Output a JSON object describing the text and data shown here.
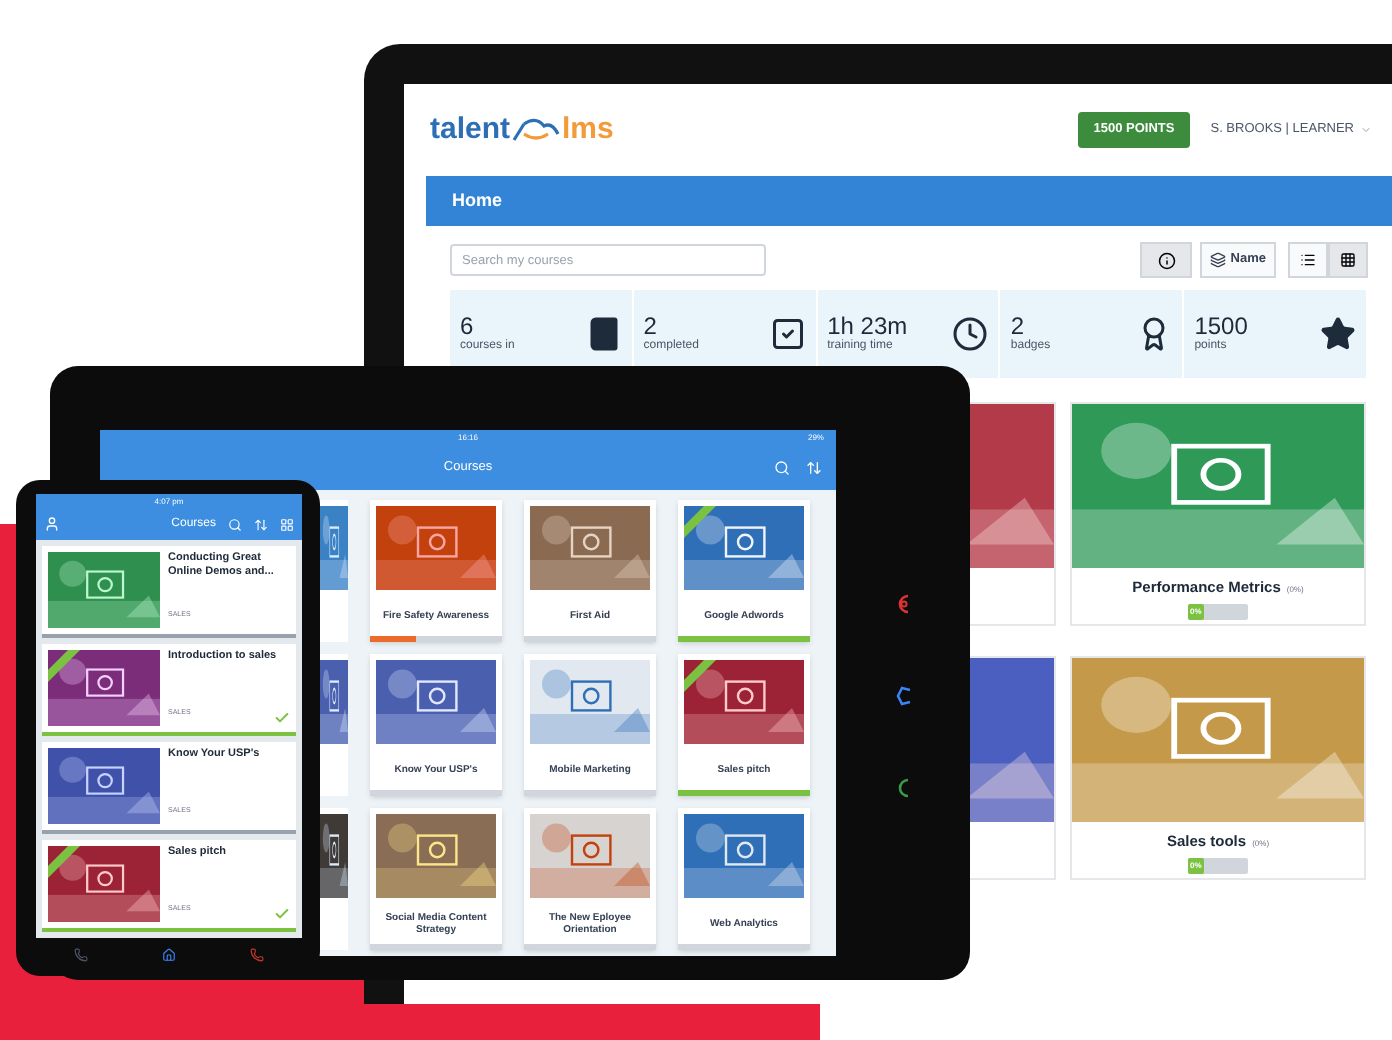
{
  "laptop": {
    "logo": {
      "left": "talent",
      "right": "lms"
    },
    "points_button": "1500 POINTS",
    "user_menu": "S. BROOKS | LEARNER",
    "page_title": "Home",
    "search": {
      "placeholder": "Search my courses"
    },
    "sort_button": "Name",
    "view_toggles": [
      {
        "kind": "list",
        "selected": false
      },
      {
        "kind": "grid",
        "selected": true
      }
    ],
    "stats": [
      {
        "value": "6",
        "label": "courses in",
        "kind": "book"
      },
      {
        "value": "2",
        "label": "completed",
        "kind": "check"
      },
      {
        "value": "1h 23m",
        "label": "training time",
        "kind": "clock"
      },
      {
        "value": "2",
        "label": "badges",
        "kind": "badge"
      },
      {
        "value": "1500",
        "label": "points",
        "kind": "star"
      }
    ],
    "courses": [
      {
        "title": "Performance Metrics",
        "percent": "(0%)",
        "progress": "0%",
        "level": 0
      },
      {
        "title": "Sales tools",
        "percent": "(0%)",
        "progress": "0%",
        "level": 0
      }
    ]
  },
  "tablet": {
    "time": "16:16",
    "battery": "29%",
    "title": "Courses",
    "courses": [
      {
        "title": "Fire Safety Awareness",
        "completed": false,
        "level": 0.35
      },
      {
        "title": "First Aid",
        "completed": false,
        "level": 0
      },
      {
        "title": "Google Adwords",
        "completed": true,
        "level": 1
      },
      {
        "title": "Know Your USP's",
        "completed": false,
        "level": 0
      },
      {
        "title": "Mobile Marketing",
        "completed": false,
        "level": 0
      },
      {
        "title": "Sales pitch",
        "completed": true,
        "level": 1
      },
      {
        "title": "Social Media Content Strategy",
        "completed": false,
        "level": 0
      },
      {
        "title": "The New Eployee Orientation",
        "completed": false,
        "level": 0
      },
      {
        "title": "Web Analytics",
        "completed": false,
        "level": 0
      }
    ]
  },
  "phone": {
    "time": "4:07 pm",
    "title": "Courses",
    "courses": [
      {
        "title": "Conducting Great Online Demos and...",
        "category": "SALES",
        "completed": false,
        "level": 0
      },
      {
        "title": "Introduction to sales",
        "category": "SALES",
        "completed": true,
        "level": 1
      },
      {
        "title": "Know Your USP's",
        "category": "SALES",
        "completed": false,
        "level": 0
      },
      {
        "title": "Sales pitch",
        "category": "SALES",
        "completed": true,
        "level": 1
      }
    ]
  }
}
